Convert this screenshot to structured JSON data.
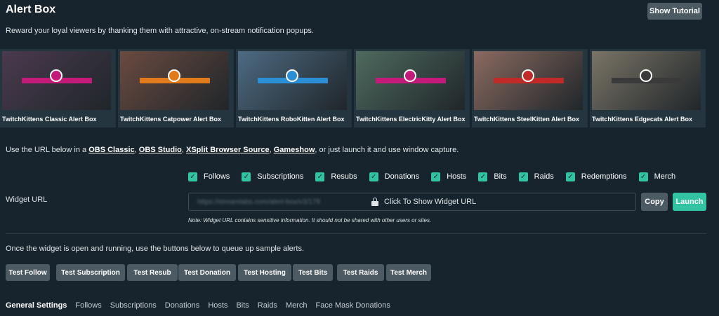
{
  "header": {
    "title": "Alert Box",
    "tutorial_label": "Show Tutorial",
    "subtitle": "Reward your loyal viewers by thanking them with attractive, on-stream notification popups."
  },
  "themes": [
    {
      "label": "TwitchKittens Classic Alert Box",
      "bg": "#4a3a4e",
      "accent": "#c41b7a"
    },
    {
      "label": "TwitchKittens Catpower Alert Box",
      "bg": "#6a4a40",
      "accent": "#e07a1a"
    },
    {
      "label": "TwitchKittens RoboKitten Alert Box",
      "bg": "#4d6a82",
      "accent": "#2a8fd6"
    },
    {
      "label": "TwitchKittens ElectricKitty Alert Box",
      "bg": "#4e6a5e",
      "accent": "#c41b7a"
    },
    {
      "label": "TwitchKittens SteelKitten Alert Box",
      "bg": "#8a6a60",
      "accent": "#c22a2a"
    },
    {
      "label": "TwitchKittens Edgecats Alert Box",
      "bg": "#7a7466",
      "accent": "#3a3a3a"
    }
  ],
  "url_intro": {
    "prefix": "Use the URL below in a ",
    "links": [
      "OBS Classic",
      "OBS Studio",
      "XSplit Browser Source",
      "Gameshow"
    ],
    "sep1": ", ",
    "sep2": ", ",
    "sep3": ", ",
    "suffix": ", or just launch it and use window capture."
  },
  "alert_types": [
    {
      "label": "Follows",
      "checked": true
    },
    {
      "label": "Subscriptions",
      "checked": true
    },
    {
      "label": "Resubs",
      "checked": true
    },
    {
      "label": "Donations",
      "checked": true
    },
    {
      "label": "Hosts",
      "checked": true
    },
    {
      "label": "Bits",
      "checked": true
    },
    {
      "label": "Raids",
      "checked": true
    },
    {
      "label": "Redemptions",
      "checked": true
    },
    {
      "label": "Merch",
      "checked": true
    }
  ],
  "widget": {
    "label": "Widget URL",
    "url_hidden": "https://streamlabs.com/alert-box/v3/179",
    "show_label": "Click To Show Widget URL",
    "copy_label": "Copy",
    "launch_label": "Launch",
    "note": "Note: Widget URL contains sensitive information. It should not be shared with other users or sites."
  },
  "queue_text": "Once the widget is open and running, use the buttons below to queue up sample alerts.",
  "test_buttons": [
    "Test Follow",
    "Test Subscription",
    "Test Resub",
    "Test Donation",
    "Test Hosting",
    "Test Bits",
    "Test Raids",
    "Test Merch"
  ],
  "tabs": [
    {
      "label": "General Settings",
      "active": true
    },
    {
      "label": "Follows",
      "active": false
    },
    {
      "label": "Subscriptions",
      "active": false
    },
    {
      "label": "Donations",
      "active": false
    },
    {
      "label": "Hosts",
      "active": false
    },
    {
      "label": "Bits",
      "active": false
    },
    {
      "label": "Raids",
      "active": false
    },
    {
      "label": "Merch",
      "active": false
    },
    {
      "label": "Face Mask Donations",
      "active": false
    }
  ],
  "colors": {
    "background": "#17242d",
    "accent": "#31c3a2",
    "button": "#4b5a63"
  }
}
